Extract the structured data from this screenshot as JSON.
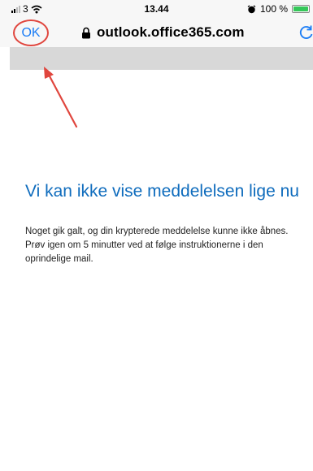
{
  "status_bar": {
    "carrier": "3",
    "time": "13.44",
    "battery_percent": "100 %",
    "battery_level": 1.0
  },
  "browser": {
    "ok_label": "OK",
    "url": "outlook.office365.com",
    "icons": [
      "lock-icon",
      "reload-icon"
    ]
  },
  "annotation": {
    "color": "#e0463e"
  },
  "message": {
    "heading": "Vi kan ikke vise meddelelsen lige nu",
    "body": "Noget gik galt, og din krypterede meddelelse kunne ikke åbnes. Prøv igen om 5 minutter ved at følge instruktionerne i den oprindelige mail."
  },
  "colors": {
    "accent": "#0f6cbd",
    "ios_blue": "#1a7cf5",
    "battery_green": "#34c759"
  }
}
